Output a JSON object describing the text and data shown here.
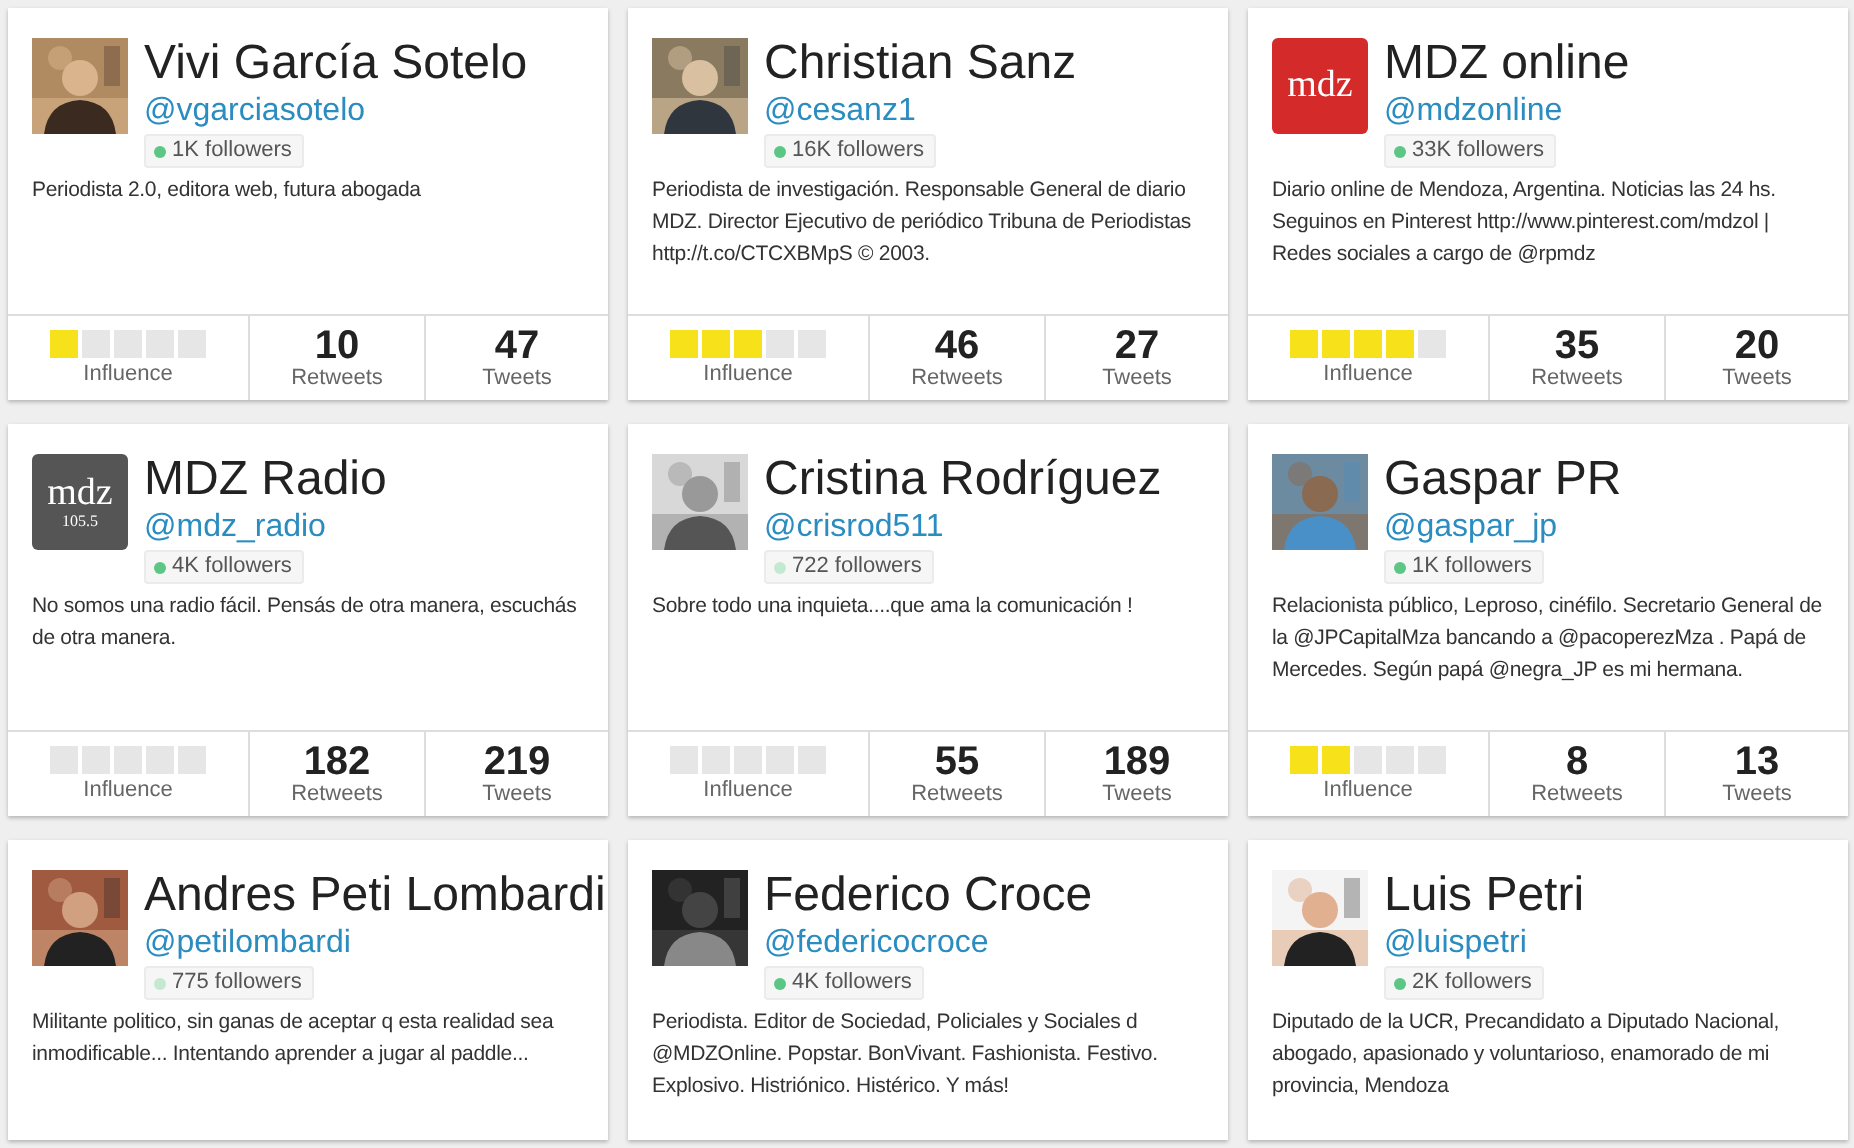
{
  "profiles": [
    {
      "name": "Vivi García Sotelo",
      "handle": "@vgarciasotelo",
      "followers": {
        "text": "1K followers",
        "color": "#5cc685"
      },
      "bio": "Periodista 2.0, editora web, futura abogada",
      "stats": {
        "influence": {
          "stars": 1,
          "label": "Influence"
        },
        "retweets": {
          "value": "10",
          "label": "Retweets"
        },
        "tweets": {
          "value": "47",
          "label": "Tweets"
        }
      }
    },
    {
      "name": "Christian Sanz",
      "handle": "@cesanz1",
      "followers": {
        "text": "16K followers",
        "color": "#5cc685"
      },
      "bio": "Periodista de investigación. Responsable General de diario MDZ. Director Ejecutivo de periódico Tribuna de Periodistas http://t.co/CTCXBMpS © 2003.",
      "stats": {
        "influence": {
          "stars": 3,
          "label": "Influence"
        },
        "retweets": {
          "value": "46",
          "label": "Retweets"
        },
        "tweets": {
          "value": "27",
          "label": "Tweets"
        }
      }
    },
    {
      "name": "MDZ online",
      "handle": "@mdzonline",
      "avatar": {
        "kind": "logo",
        "text": "mdz"
      },
      "followers": {
        "text": "33K followers",
        "color": "#5cc685"
      },
      "bio": "Diario online de Mendoza, Argentina. Noticias las 24 hs. Seguinos en Pinterest http://www.pinterest.com/mdzol | Redes sociales a cargo de @rpmdz",
      "stats": {
        "influence": {
          "stars": 4,
          "label": "Influence"
        },
        "retweets": {
          "value": "35",
          "label": "Retweets"
        },
        "tweets": {
          "value": "20",
          "label": "Tweets"
        }
      }
    },
    {
      "name": "MDZ Radio",
      "handle": "@mdz_radio",
      "avatar": {
        "kind": "logo",
        "text": "mdz",
        "subtext": "105.5"
      },
      "followers": {
        "text": "4K followers",
        "color": "#5cc685"
      },
      "bio": "No somos una radio fácil. Pensás de otra manera, escuchás de otra manera.",
      "stats": {
        "influence": {
          "stars": 0,
          "label": "Influence"
        },
        "retweets": {
          "value": "182",
          "label": "Retweets"
        },
        "tweets": {
          "value": "219",
          "label": "Tweets"
        }
      }
    },
    {
      "name": "Cristina Rodríguez",
      "handle": "@crisrod511",
      "followers": {
        "text": "722 followers",
        "color": "#c4e9d1"
      },
      "bio": "Sobre todo una inquieta....que ama la comunicación !",
      "stats": {
        "influence": {
          "stars": 0,
          "label": "Influence"
        },
        "retweets": {
          "value": "55",
          "label": "Retweets"
        },
        "tweets": {
          "value": "189",
          "label": "Tweets"
        }
      }
    },
    {
      "name": "Gaspar PR",
      "handle": "@gaspar_jp",
      "followers": {
        "text": "1K followers",
        "color": "#5cc685"
      },
      "bio": "Relacionista público, Leproso, cinéfilo. Secretario General de la @JPCapitalMza bancando a @pacoperezMza . Papá de Mercedes. Según papá @negra_JP es mi hermana.",
      "stats": {
        "influence": {
          "stars": 2,
          "label": "Influence"
        },
        "retweets": {
          "value": "8",
          "label": "Retweets"
        },
        "tweets": {
          "value": "13",
          "label": "Tweets"
        }
      }
    },
    {
      "name": "Andres Peti Lombardi",
      "handle": "@petilombardi",
      "followers": {
        "text": "775 followers",
        "color": "#c4e9d1"
      },
      "bio": "Militante politico, sin ganas de aceptar q esta realidad sea inmodificable... Intentando aprender a jugar al paddle..."
    },
    {
      "name": "Federico Croce",
      "handle": "@federicocroce",
      "followers": {
        "text": "4K followers",
        "color": "#5cc685"
      },
      "bio": "Periodista. Editor de Sociedad, Policiales y Sociales d @MDZOnline. Popstar. BonVivant. Fashionista. Festivo. Explosivo. Histriónico. Histérico. Y más!"
    },
    {
      "name": "Luis Petri",
      "handle": "@luispetri",
      "followers": {
        "text": "2K followers",
        "color": "#5cc685"
      },
      "bio": "Diputado de la UCR, Precandidato a Diputado Nacional, abogado, apasionado y voluntarioso, enamorado de mi provincia, Mendoza"
    }
  ]
}
